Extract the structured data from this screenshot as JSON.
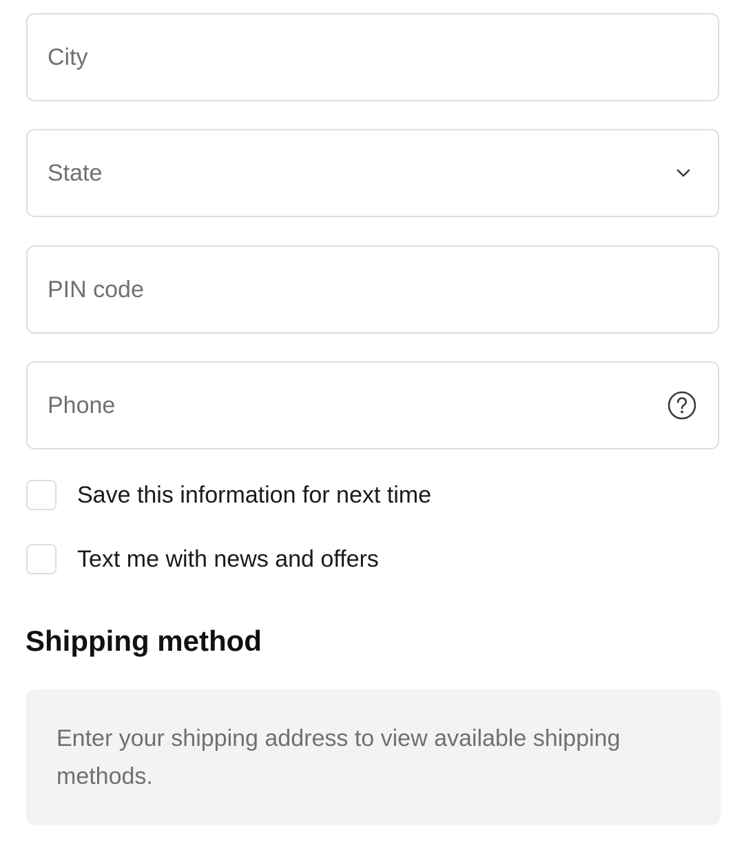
{
  "form": {
    "city": {
      "placeholder": "City",
      "value": ""
    },
    "state": {
      "placeholder": "State",
      "value": ""
    },
    "pin": {
      "placeholder": "PIN code",
      "value": ""
    },
    "phone": {
      "placeholder": "Phone",
      "value": ""
    }
  },
  "checkboxes": {
    "save_info": {
      "label": "Save this information for next time",
      "checked": false
    },
    "text_offers": {
      "label": "Text me with news and offers",
      "checked": false
    }
  },
  "shipping": {
    "title": "Shipping method",
    "notice": "Enter your shipping address to view available shipping methods."
  },
  "icons": {
    "state_dropdown": "chevron-down-icon",
    "phone_help": "help-circle-icon"
  },
  "colors": {
    "border": "#dedede",
    "placeholder": "#707070",
    "text": "#1a1a1a",
    "notice_bg": "#f3f3f3"
  }
}
